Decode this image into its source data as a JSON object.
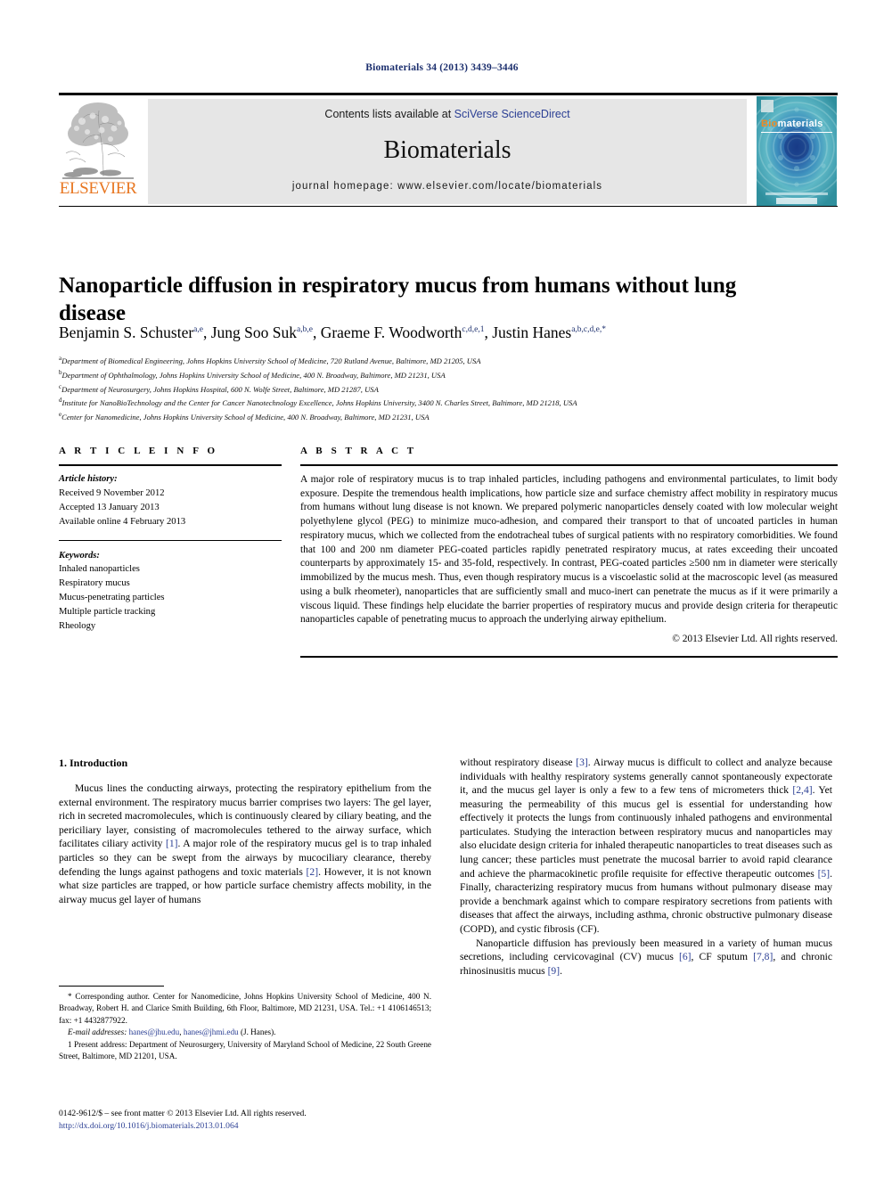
{
  "running_head": "Biomaterials 34 (2013) 3439–3446",
  "masthead": {
    "publisher_name": "ELSEVIER",
    "contents_prefix": "Contents lists available at ",
    "contents_link": "SciVerse ScienceDirect",
    "journal_title": "Biomaterials",
    "homepage": "journal homepage: www.elsevier.com/locate/biomaterials",
    "cover": {
      "title_part1": "Bio",
      "title_part2": "materials"
    }
  },
  "article": {
    "title": "Nanoparticle diffusion in respiratory mucus from humans without lung disease",
    "authors": [
      {
        "name": "Benjamin S. Schuster",
        "sup": "a,e",
        "sep": ", "
      },
      {
        "name": "Jung Soo Suk",
        "sup": "a,b,e",
        "sep": ", "
      },
      {
        "name": "Graeme F. Woodworth",
        "sup": "c,d,e,1",
        "sep": ", "
      },
      {
        "name": "Justin Hanes",
        "sup": "a,b,c,d,e,*",
        "sep": ""
      }
    ],
    "affiliations": [
      {
        "marker": "a",
        "text": "Department of Biomedical Engineering, Johns Hopkins University School of Medicine, 720 Rutland Avenue, Baltimore, MD 21205, USA"
      },
      {
        "marker": "b",
        "text": "Department of Ophthalmology, Johns Hopkins University School of Medicine, 400 N. Broadway, Baltimore, MD 21231, USA"
      },
      {
        "marker": "c",
        "text": "Department of Neurosurgery, Johns Hopkins Hospital, 600 N. Wolfe Street, Baltimore, MD 21287, USA"
      },
      {
        "marker": "d",
        "text": "Institute for NanoBioTechnology and the Center for Cancer Nanotechnology Excellence, Johns Hopkins University, 3400 N. Charles Street, Baltimore, MD 21218, USA"
      },
      {
        "marker": "e",
        "text": "Center for Nanomedicine, Johns Hopkins University School of Medicine, 400 N. Broadway, Baltimore, MD 21231, USA"
      }
    ]
  },
  "article_info": {
    "heading": "A R T I C L E   I N F O",
    "history_label": "Article history:",
    "history": [
      "Received 9 November 2012",
      "Accepted 13 January 2013",
      "Available online 4 February 2013"
    ],
    "keywords_label": "Keywords:",
    "keywords": [
      "Inhaled nanoparticles",
      "Respiratory mucus",
      "Mucus-penetrating particles",
      "Multiple particle tracking",
      "Rheology"
    ]
  },
  "abstract": {
    "heading": "A B S T R A C T",
    "text": "A major role of respiratory mucus is to trap inhaled particles, including pathogens and environmental particulates, to limit body exposure. Despite the tremendous health implications, how particle size and surface chemistry affect mobility in respiratory mucus from humans without lung disease is not known. We prepared polymeric nanoparticles densely coated with low molecular weight polyethylene glycol (PEG) to minimize muco-adhesion, and compared their transport to that of uncoated particles in human respiratory mucus, which we collected from the endotracheal tubes of surgical patients with no respiratory comorbidities. We found that 100 and 200 nm diameter PEG-coated particles rapidly penetrated respiratory mucus, at rates exceeding their uncoated counterparts by approximately 15- and 35-fold, respectively. In contrast, PEG-coated particles ≥500 nm in diameter were sterically immobilized by the mucus mesh. Thus, even though respiratory mucus is a viscoelastic solid at the macroscopic level (as measured using a bulk rheometer), nanoparticles that are sufficiently small and muco-inert can penetrate the mucus as if it were primarily a viscous liquid. These findings help elucidate the barrier properties of respiratory mucus and provide design criteria for therapeutic nanoparticles capable of penetrating mucus to approach the underlying airway epithelium.",
    "copyright": "© 2013 Elsevier Ltd. All rights reserved."
  },
  "body": {
    "section_heading": "1. Introduction",
    "left_paragraph_1_a": "Mucus lines the conducting airways, protecting the respiratory epithelium from the external environment. The respiratory mucus barrier comprises two layers: The gel layer, rich in secreted macromolecules, which is continuously cleared by ciliary beating, and the periciliary layer, consisting of macromolecules tethered to the airway surface, which facilitates ciliary activity ",
    "left_ref_1": "[1]",
    "left_paragraph_1_b": ". A major role of the respiratory mucus gel is to trap inhaled particles so they can be swept from the airways by mucociliary clearance, thereby defending the lungs against pathogens and toxic materials ",
    "left_ref_2": "[2]",
    "left_paragraph_1_c": ". However, it is not known what size particles are trapped, or how particle surface chemistry affects mobility, in the airway mucus gel layer of humans",
    "right_paragraph_1_a": "without respiratory disease ",
    "right_ref_3": "[3]",
    "right_paragraph_1_b": ". Airway mucus is difficult to collect and analyze because individuals with healthy respiratory systems generally cannot spontaneously expectorate it, and the mucus gel layer is only a few to a few tens of micrometers thick ",
    "right_ref_24": "[2,4]",
    "right_paragraph_1_c": ". Yet measuring the permeability of this mucus gel is essential for understanding how effectively it protects the lungs from continuously inhaled pathogens and environmental particulates. Studying the interaction between respiratory mucus and nanoparticles may also elucidate design criteria for inhaled therapeutic nanoparticles to treat diseases such as lung cancer; these particles must penetrate the mucosal barrier to avoid rapid clearance and achieve the pharmacokinetic profile requisite for effective therapeutic outcomes ",
    "right_ref_5": "[5]",
    "right_paragraph_1_d": ". Finally, characterizing respiratory mucus from humans without pulmonary disease may provide a benchmark against which to compare respiratory secretions from patients with diseases that affect the airways, including asthma, chronic obstructive pulmonary disease (COPD), and cystic fibrosis (CF).",
    "right_paragraph_2_a": "Nanoparticle diffusion has previously been measured in a variety of human mucus secretions, including cervicovaginal (CV) mucus ",
    "right_ref_6": "[6]",
    "right_paragraph_2_b": ", CF sputum ",
    "right_ref_78": "[7,8]",
    "right_paragraph_2_c": ", and chronic rhinosinusitis mucus ",
    "right_ref_9": "[9]",
    "right_paragraph_2_d": "."
  },
  "footnotes": {
    "corresponding": "* Corresponding author. Center for Nanomedicine, Johns Hopkins University School of Medicine, 400 N. Broadway, Robert H. and Clarice Smith Building, 6th Floor, Baltimore, MD 21231, USA. Tel.: +1 4106146513; fax: +1 4432877922.",
    "email_label": "E-mail addresses:",
    "email_1": "hanes@jhu.edu",
    "email_sep": ", ",
    "email_2": "hanes@jhmi.edu",
    "email_suffix": " (J. Hanes).",
    "present_address": "1 Present address: Department of Neurosurgery, University of Maryland School of Medicine, 22 South Greene Street, Baltimore, MD 21201, USA."
  },
  "colophon": {
    "line1": "0142-9612/$ – see front matter © 2013 Elsevier Ltd. All rights reserved.",
    "doi": "http://dx.doi.org/10.1016/j.biomaterials.2013.01.064"
  }
}
